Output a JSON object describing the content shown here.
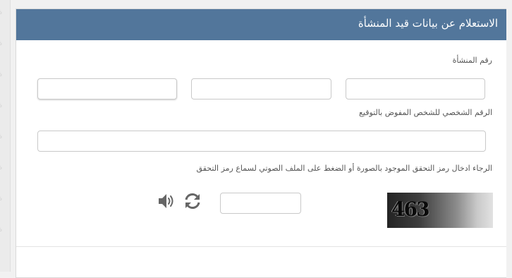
{
  "header": {
    "title": "الاستعلام عن بيانات قيد المنشأة"
  },
  "form": {
    "establishment_number_label": "رقم المنشأة",
    "delegate_id_label": "الرقم الشخصي للشخص المفوض بالتوقيع",
    "captcha_instruction": "الرجاء ادخال رمز التحقق الموجود بالصورة أو الضغط على الملف الصوتي لسماع رمز التحقق",
    "captcha_code": "463",
    "captcha_input_value": "",
    "delegate_id_value": "",
    "establishment_fields": [
      "",
      "",
      ""
    ]
  },
  "icons": {
    "audio": "speaker-icon",
    "refresh": "refresh-icon"
  },
  "colors": {
    "header_bg": "#52769b",
    "header_text": "#ffffff"
  }
}
